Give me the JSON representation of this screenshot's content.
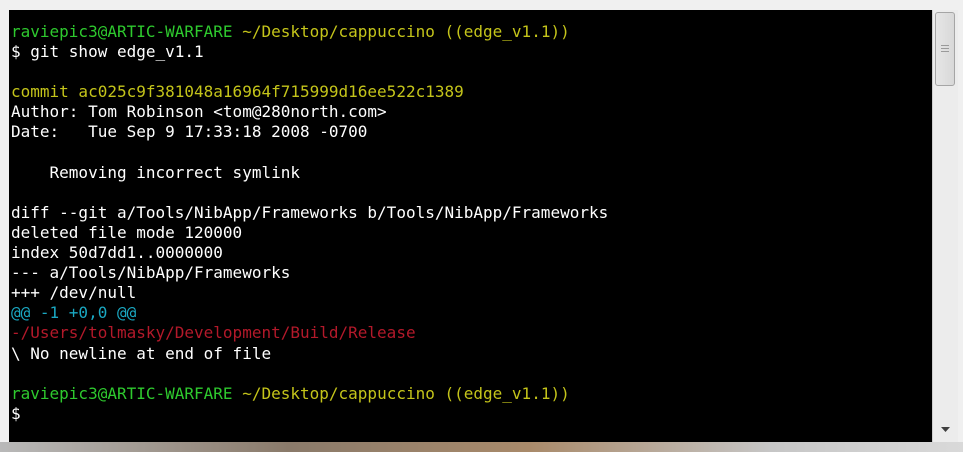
{
  "terminal": {
    "lines": [
      {
        "segments": [
          {
            "text": "raviepic3@ARTIC-WARFARE",
            "color": "green"
          },
          {
            "text": " ",
            "color": "white"
          },
          {
            "text": "~/Desktop/cappuccino ((edge_v1.1))",
            "color": "yellow"
          }
        ]
      },
      {
        "segments": [
          {
            "text": "$ git show edge_v1.1",
            "color": "white"
          }
        ]
      },
      {
        "segments": [
          {
            "text": "",
            "color": "white"
          }
        ]
      },
      {
        "segments": [
          {
            "text": "commit ac025c9f381048a16964f715999d16ee522c1389",
            "color": "yellow"
          }
        ]
      },
      {
        "segments": [
          {
            "text": "Author: Tom Robinson <tom@280north.com>",
            "color": "white"
          }
        ]
      },
      {
        "segments": [
          {
            "text": "Date:   Tue Sep 9 17:33:18 2008 -0700",
            "color": "white"
          }
        ]
      },
      {
        "segments": [
          {
            "text": "",
            "color": "white"
          }
        ]
      },
      {
        "segments": [
          {
            "text": "    Removing incorrect symlink",
            "color": "white"
          }
        ]
      },
      {
        "segments": [
          {
            "text": "",
            "color": "white"
          }
        ]
      },
      {
        "segments": [
          {
            "text": "diff --git a/Tools/NibApp/Frameworks b/Tools/NibApp/Frameworks",
            "color": "white"
          }
        ]
      },
      {
        "segments": [
          {
            "text": "deleted file mode 120000",
            "color": "white"
          }
        ]
      },
      {
        "segments": [
          {
            "text": "index 50d7dd1..0000000",
            "color": "white"
          }
        ]
      },
      {
        "segments": [
          {
            "text": "--- a/Tools/NibApp/Frameworks",
            "color": "white"
          }
        ]
      },
      {
        "segments": [
          {
            "text": "+++ /dev/null",
            "color": "white"
          }
        ]
      },
      {
        "segments": [
          {
            "text": "@@ -1 +0,0 @@",
            "color": "cyan"
          }
        ]
      },
      {
        "segments": [
          {
            "text": "-/Users/tolmasky/Development/Build/Release",
            "color": "red"
          }
        ]
      },
      {
        "segments": [
          {
            "text": "\\ No newline at end of file",
            "color": "white"
          }
        ]
      },
      {
        "segments": [
          {
            "text": "",
            "color": "white"
          }
        ]
      },
      {
        "segments": [
          {
            "text": "raviepic3@ARTIC-WARFARE",
            "color": "green"
          },
          {
            "text": " ",
            "color": "white"
          },
          {
            "text": "~/Desktop/cappuccino ((edge_v1.1))",
            "color": "yellow"
          }
        ]
      },
      {
        "segments": [
          {
            "text": "$",
            "color": "white"
          }
        ]
      }
    ]
  },
  "scrollbar": {
    "thumb_icon": "scroll-thumb-grip-icon",
    "down_icon": "scroll-down-arrow-icon"
  },
  "colors": {
    "green": "#2ec92e",
    "yellow": "#c4c41a",
    "white": "#ffffff",
    "cyan": "#1aa8c2",
    "red": "#b3192a",
    "background": "#000000"
  }
}
